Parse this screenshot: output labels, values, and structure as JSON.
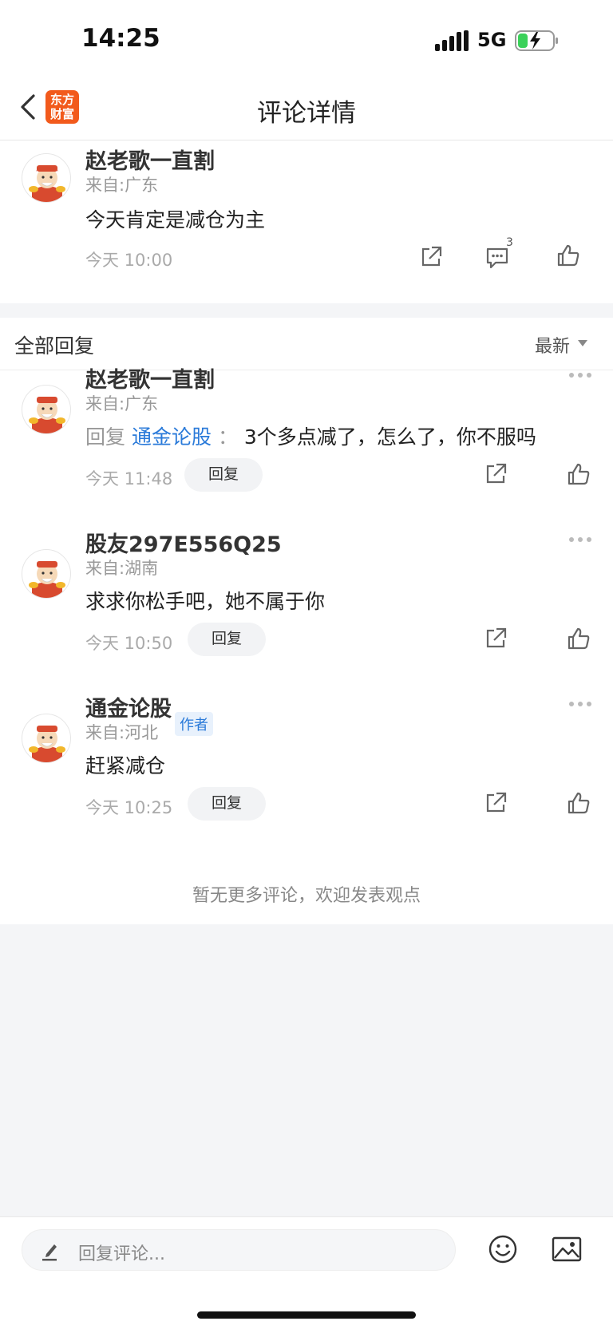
{
  "status": {
    "time": "14:25",
    "network": "5G"
  },
  "header": {
    "title": "评论详情",
    "logo_line1": "东方",
    "logo_line2": "财富"
  },
  "main_comment": {
    "username": "赵老歌一直割",
    "location": "来自:广东",
    "content": "今天肯定是减仓为主",
    "time": "今天 10:00",
    "reply_count": "3"
  },
  "replies_section": {
    "title": "全部回复",
    "sort": "最新"
  },
  "replies": [
    {
      "username": "赵老歌一直割",
      "location": "来自:广东",
      "reply_prefix": "回复",
      "reply_to": "通金论股",
      "separator": "：",
      "content": "3个多点减了，怎么了，你不服吗",
      "time": "今天 11:48",
      "reply_label": "回复"
    },
    {
      "username": "股友297E556Q25",
      "location": "来自:湖南",
      "content": "求求你松手吧，她不属于你",
      "time": "今天 10:50",
      "reply_label": "回复"
    },
    {
      "username": "通金论股",
      "author_tag": "作者",
      "location": "来自:河北",
      "content": "赶紧减仓",
      "time": "今天 10:25",
      "reply_label": "回复"
    }
  ],
  "footer_note": "暂无更多评论，欢迎发表观点",
  "bottom_bar": {
    "placeholder": "回复评论..."
  },
  "colors": {
    "accent": "#2a7ad9",
    "brand": "#f25a1c"
  }
}
